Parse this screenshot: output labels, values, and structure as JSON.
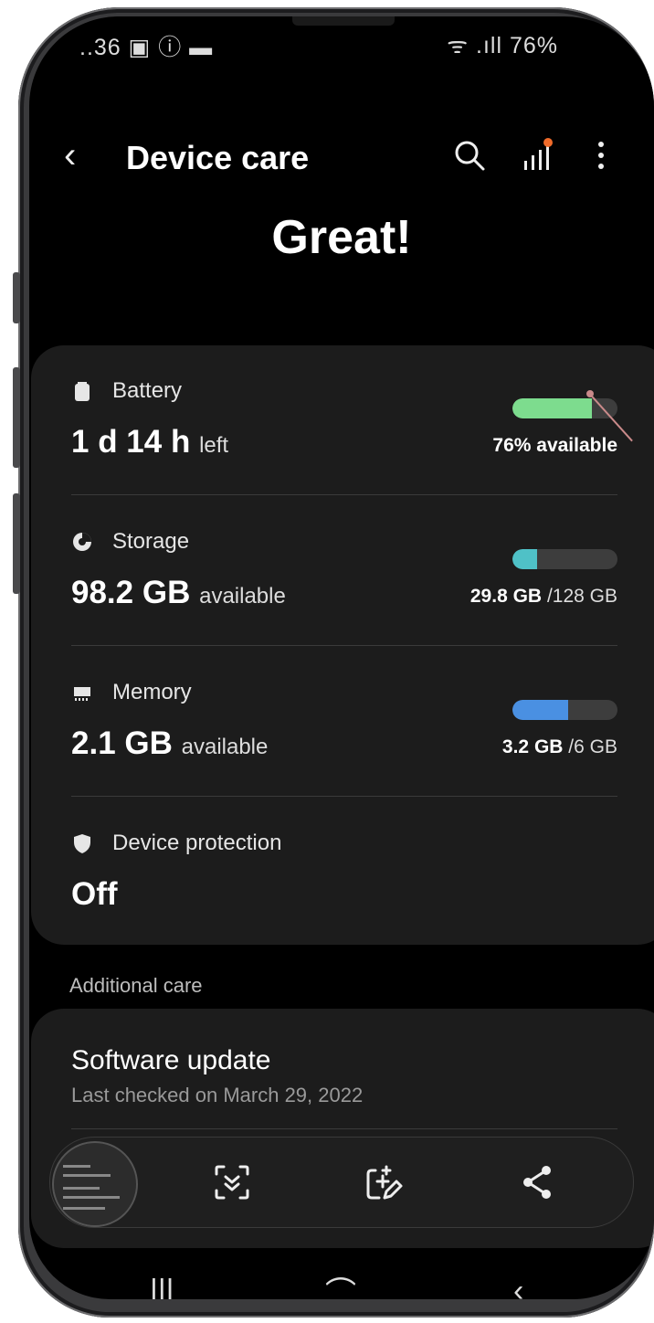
{
  "status_bar": {
    "left": "..36 ▣ ⓘ ▬",
    "right": "ᯤ .ıll 76%"
  },
  "app_bar": {
    "title": "Device care",
    "back_icon": "back-arrow-icon",
    "actions": [
      "search-icon",
      "signal-diagnostics-icon",
      "more-vert-icon"
    ]
  },
  "hero": {
    "status": "Great!"
  },
  "rows": {
    "battery": {
      "label": "Battery",
      "value": "1 d 14 h",
      "unit": "left",
      "caption": "76% available",
      "fill": 0.76,
      "color": "#7ddc8e"
    },
    "storage": {
      "label": "Storage",
      "value": "98.2 GB",
      "unit": "available",
      "used": "29.8 GB",
      "total": "/128 GB",
      "fill": 0.233,
      "color": "#4fc1c7"
    },
    "memory": {
      "label": "Memory",
      "value": "2.1 GB",
      "unit": "available",
      "used": "3.2 GB",
      "total": "/6 GB",
      "fill": 0.533,
      "color": "#4a90e2"
    },
    "protection": {
      "label": "Device protection",
      "value": "Off"
    }
  },
  "additional": {
    "header": "Additional care",
    "software_update": {
      "title": "Software update",
      "subtitle": "Last checked on March 29, 2022"
    }
  },
  "screenshot_toolbar": {
    "icons": [
      "screenshot-thumbnail",
      "scroll-capture-icon",
      "edit-screenshot-icon",
      "share-icon"
    ]
  },
  "nav_bar": {
    "recent": "|||",
    "home": "⌒",
    "back": "‹"
  }
}
